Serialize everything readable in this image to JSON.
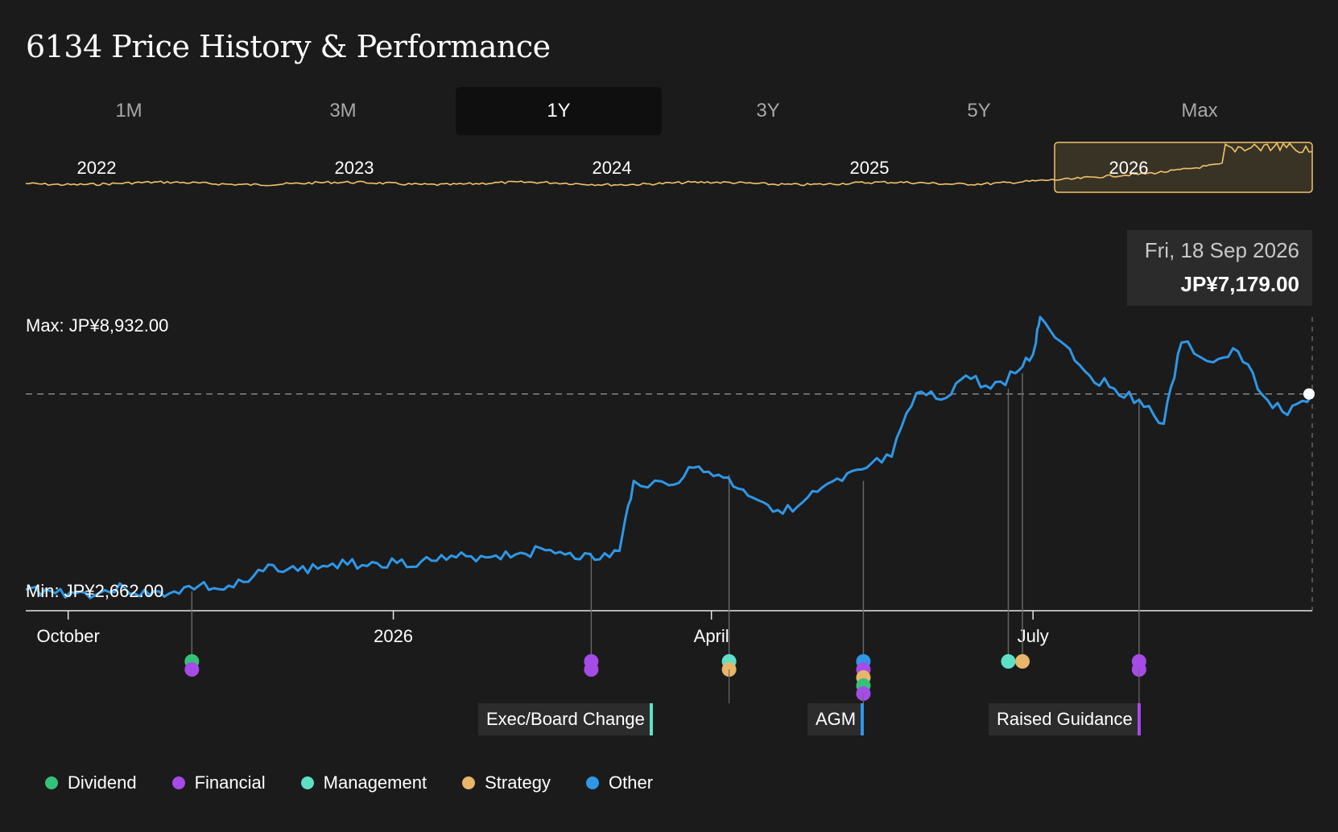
{
  "title": "6134 Price History & Performance",
  "tabs": [
    "1M",
    "3M",
    "1Y",
    "3Y",
    "5Y",
    "Max"
  ],
  "active_tab": "1Y",
  "tooltip": {
    "date": "Fri, 18 Sep 2026",
    "price": "JP¥7,179.00"
  },
  "colors": {
    "price_line": "#2f97e6",
    "navigator_line": "#f2c36b",
    "Dividend": "#34c27a",
    "Financial": "#a54be8",
    "Management": "#5ee0c8",
    "Strategy": "#e8b56a",
    "Other": "#2f97e6"
  },
  "legend": [
    "Dividend",
    "Financial",
    "Management",
    "Strategy",
    "Other"
  ],
  "event_labels": [
    {
      "text": "Exec/Board Change",
      "category": "Management"
    },
    {
      "text": "AGM",
      "category": "Other"
    },
    {
      "text": "Raised Guidance",
      "category": "Financial"
    }
  ],
  "chart_data": {
    "type": "line",
    "series": [
      {
        "values": [
          [
            "2025-09-19",
            2720
          ],
          [
            "2025-09-26",
            2690
          ],
          [
            "2025-10-03",
            2640
          ],
          [
            "2025-10-10",
            2650
          ],
          [
            "2025-10-17",
            2760
          ],
          [
            "2025-10-24",
            2600
          ],
          [
            "2025-10-31",
            2680
          ],
          [
            "2025-11-07",
            2810
          ],
          [
            "2025-11-14",
            2720
          ],
          [
            "2025-11-21",
            2900
          ],
          [
            "2025-11-28",
            3280
          ],
          [
            "2025-12-05",
            3150
          ],
          [
            "2025-12-12",
            3260
          ],
          [
            "2025-12-19",
            3290
          ],
          [
            "2025-12-26",
            3350
          ],
          [
            "2026-01-02",
            3330
          ],
          [
            "2026-01-09",
            3370
          ],
          [
            "2026-01-16",
            3400
          ],
          [
            "2026-01-23",
            3480
          ],
          [
            "2026-01-30",
            3500
          ],
          [
            "2026-02-06",
            3560
          ],
          [
            "2026-02-13",
            3620
          ],
          [
            "2026-02-20",
            3560
          ],
          [
            "2026-02-27",
            3400
          ],
          [
            "2026-03-06",
            3600
          ],
          [
            "2026-03-10",
            5200
          ],
          [
            "2026-03-20",
            5100
          ],
          [
            "2026-03-27",
            5500
          ],
          [
            "2026-04-03",
            5340
          ],
          [
            "2026-04-10",
            5000
          ],
          [
            "2026-04-17",
            4650
          ],
          [
            "2026-04-24",
            4500
          ],
          [
            "2026-05-01",
            4950
          ],
          [
            "2026-05-08",
            5200
          ],
          [
            "2026-05-15",
            5500
          ],
          [
            "2026-05-22",
            5750
          ],
          [
            "2026-05-29",
            7200
          ],
          [
            "2026-06-05",
            7050
          ],
          [
            "2026-06-12",
            7600
          ],
          [
            "2026-06-19",
            7300
          ],
          [
            "2026-06-26",
            7650
          ],
          [
            "2026-07-01",
            8080
          ],
          [
            "2026-07-03",
            8932
          ],
          [
            "2026-07-10",
            8300
          ],
          [
            "2026-07-17",
            7600
          ],
          [
            "2026-07-24",
            7300
          ],
          [
            "2026-07-31",
            7050
          ],
          [
            "2026-08-07",
            6500
          ],
          [
            "2026-08-12",
            8350
          ],
          [
            "2026-08-21",
            7900
          ],
          [
            "2026-08-28",
            8150
          ],
          [
            "2026-09-04",
            7150
          ],
          [
            "2026-09-11",
            6700
          ],
          [
            "2026-09-18",
            7179
          ]
        ]
      }
    ],
    "y_max_label": "Max: JP¥8,932.00",
    "y_min_label": "Min: JP¥2,662.00",
    "y_max": 8932,
    "y_min": 2662,
    "x_ticks": [
      "October",
      "2026",
      "April",
      "July"
    ],
    "navigator_years": [
      "2022",
      "2023",
      "2024",
      "2025",
      "2026"
    ],
    "events": [
      {
        "date": "2025-11-05",
        "categories": [
          "Dividend",
          "Financial"
        ]
      },
      {
        "date": "2026-02-26",
        "categories": [
          "Financial",
          "Financial"
        ]
      },
      {
        "date": "2026-04-06",
        "categories": [
          "Management",
          "Strategy"
        ]
      },
      {
        "date": "2026-05-14",
        "categories": [
          "Other",
          "Financial",
          "Strategy",
          "Dividend",
          "Financial"
        ]
      },
      {
        "date": "2026-06-24",
        "categories": [
          "Management"
        ]
      },
      {
        "date": "2026-06-28",
        "categories": [
          "Strategy"
        ]
      },
      {
        "date": "2026-07-31",
        "categories": [
          "Financial",
          "Financial"
        ]
      }
    ]
  }
}
